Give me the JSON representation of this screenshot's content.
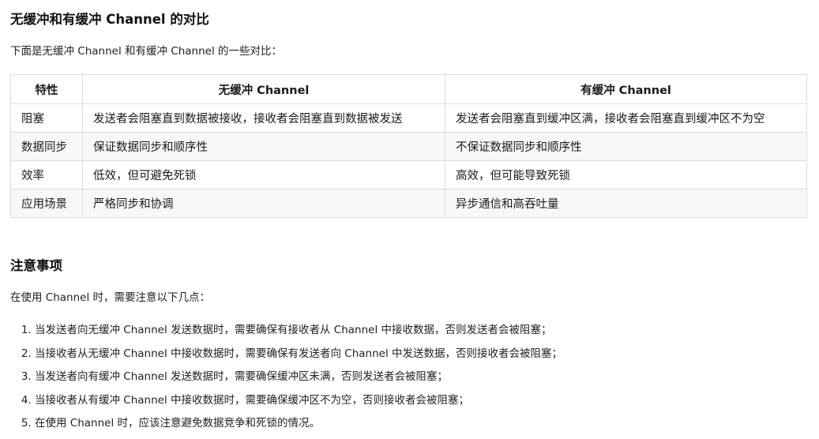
{
  "section1": {
    "title": "无缓冲和有缓冲 Channel 的对比",
    "intro": "下面是无缓冲 Channel 和有缓冲 Channel 的一些对比："
  },
  "table": {
    "headers": [
      "特性",
      "无缓冲 Channel",
      "有缓冲 Channel"
    ],
    "rows": [
      [
        "阻塞",
        "发送者会阻塞直到数据被接收，接收者会阻塞直到数据被发送",
        "发送者会阻塞直到缓冲区满，接收者会阻塞直到缓冲区不为空"
      ],
      [
        "数据同步",
        "保证数据同步和顺序性",
        "不保证数据同步和顺序性"
      ],
      [
        "效率",
        "低效，但可避免死锁",
        "高效，但可能导致死锁"
      ],
      [
        "应用场景",
        "严格同步和协调",
        "异步通信和高吞吐量"
      ]
    ]
  },
  "section2": {
    "title": "注意事项",
    "intro": "在使用 Channel 时，需要注意以下几点：",
    "items": [
      "当发送者向无缓冲 Channel 发送数据时，需要确保有接收者从 Channel 中接收数据，否则发送者会被阻塞；",
      "当接收者从无缓冲 Channel 中接收数据时，需要确保有发送者向 Channel 中发送数据，否则接收者会被阻塞；",
      "当发送者向有缓冲 Channel 发送数据时，需要确保缓冲区未满，否则发送者会被阻塞；",
      "当接收者从有缓冲 Channel 中接收数据时，需要确保缓冲区不为空，否则接收者会被阻塞；",
      "在使用 Channel 时，应该注意避免数据竞争和死锁的情况。"
    ]
  }
}
